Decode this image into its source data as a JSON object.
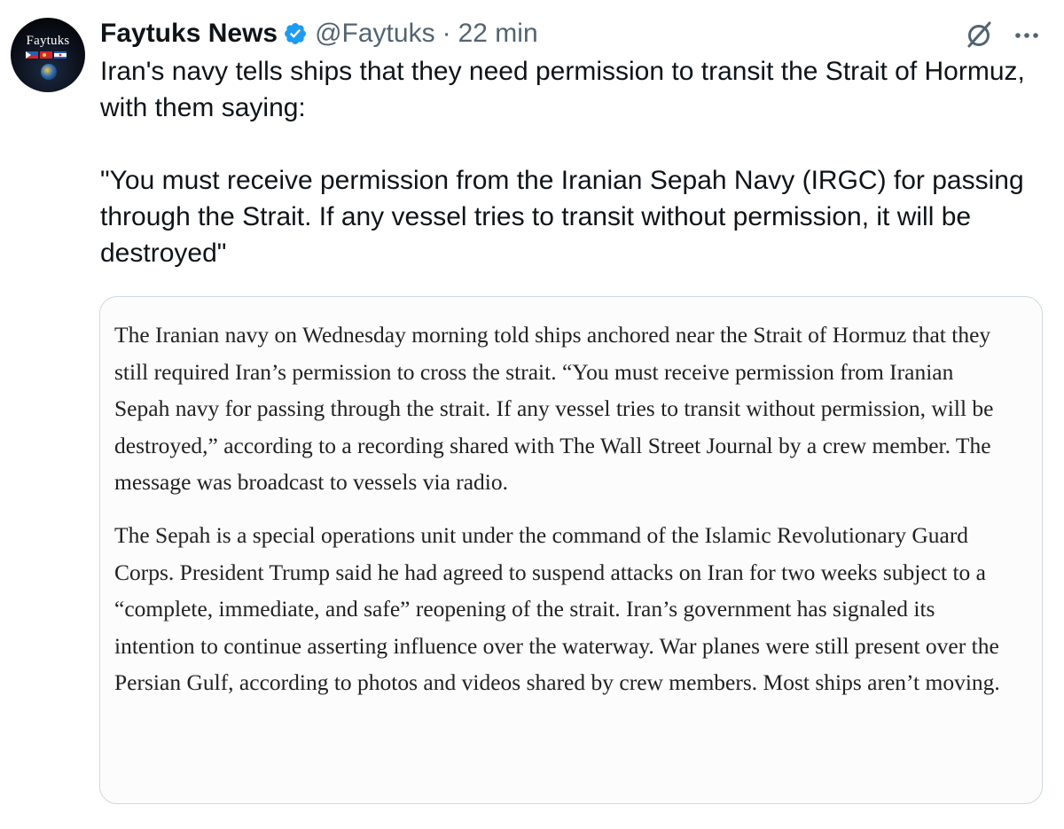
{
  "author": {
    "avatar_text": "Faytuks",
    "display_name": "Faytuks News",
    "handle": "@Faytuks",
    "separator": "·",
    "time": "22 min",
    "verified": true
  },
  "icons": {
    "verified": "verified-badge-icon",
    "grok": "grok-icon",
    "more": "more-options-icon"
  },
  "tweet": {
    "lines": [
      "Iran's navy tells ships that they need permission to transit the Strait of Hormuz, with them saying:",
      "\"You must receive permission from the Iranian Sepah Navy (IRGC) for passing through the Strait. If any vessel tries to transit without permission, it will be destroyed\""
    ]
  },
  "media": {
    "paragraphs": [
      "The Iranian navy on Wednesday morning told ships anchored near the Strait of Hormuz that they still required Iran’s permission to cross the strait. “You must receive permission from Iranian Sepah navy for passing through the strait. If any vessel tries to transit without permission, will be destroyed,” according to a recording shared with The Wall Street Journal by a crew member. The message was broadcast to vessels via radio.",
      "The Sepah is a special operations unit under the command of the Islamic Revolutionary Guard Corps. President Trump said he had agreed to suspend attacks on Iran for two weeks subject to a “complete, immediate, and safe” reopening of the strait. Iran’s government has signaled its intention to continue asserting influence over the waterway. War planes were still present over the Persian Gulf, according to photos and videos shared by crew members. Most ships aren’t moving."
    ]
  },
  "colors": {
    "text_primary": "#0f1419",
    "text_secondary": "#536471",
    "verified_blue": "#1d9bf0",
    "card_border": "#cfd9de"
  }
}
